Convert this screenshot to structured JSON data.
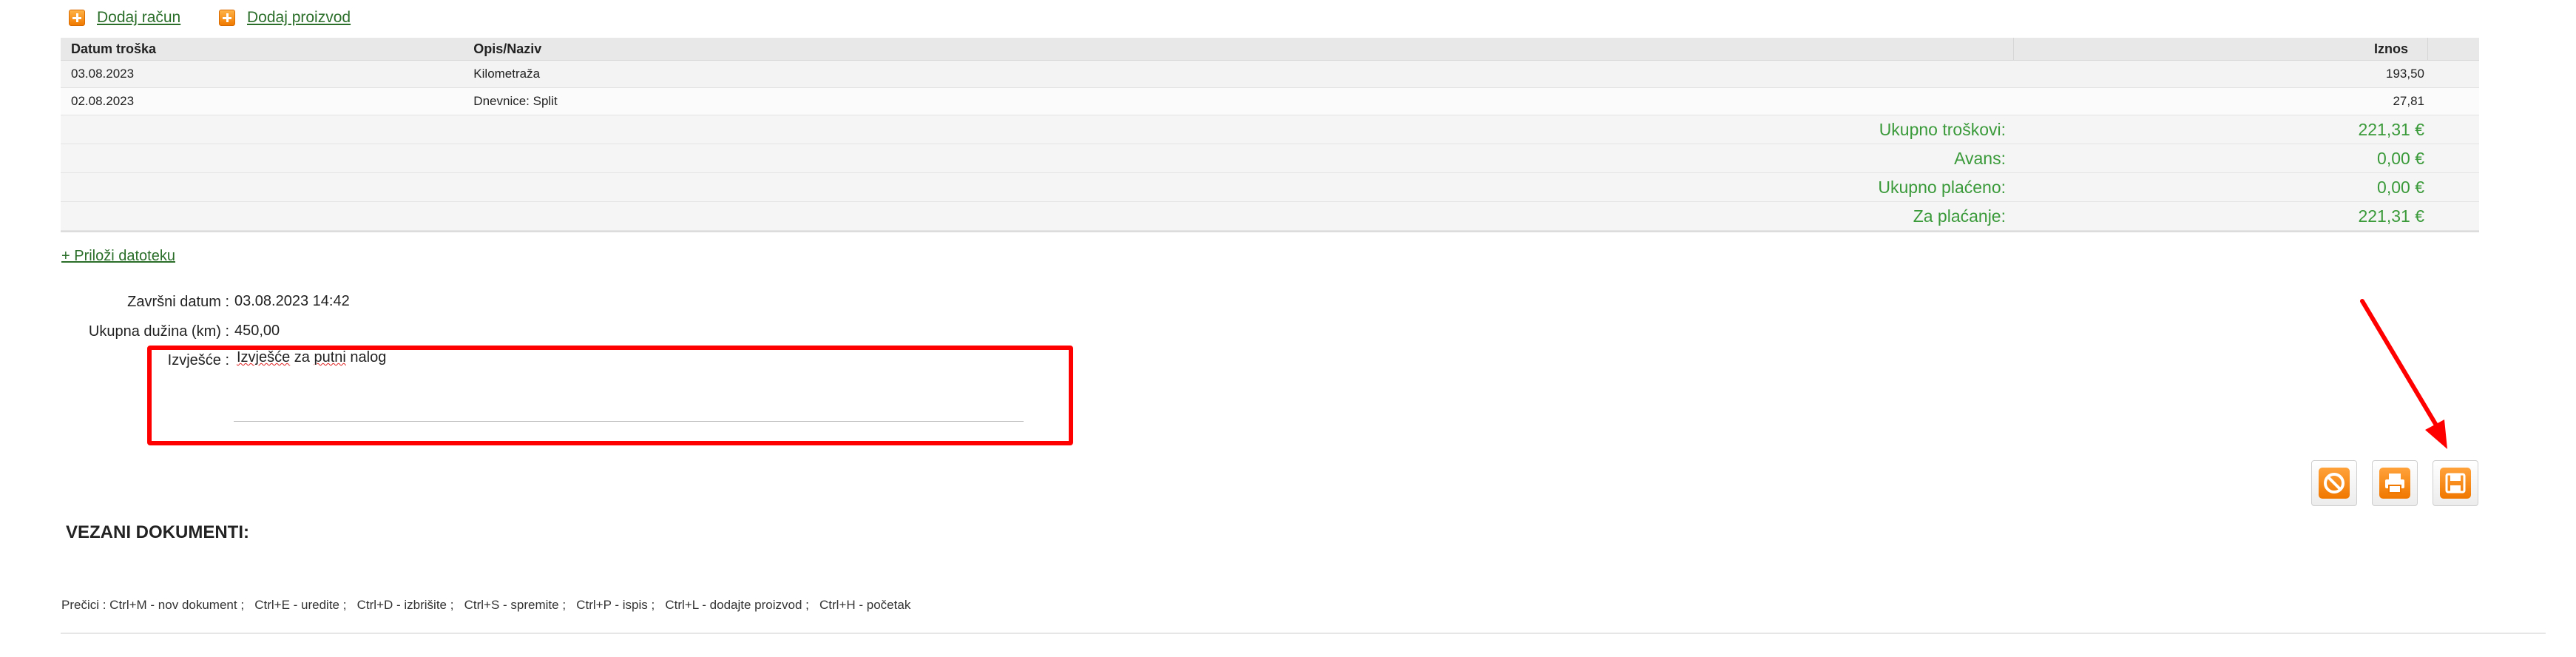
{
  "actions": {
    "add_invoice": "Dodaj račun",
    "add_product": "Dodaj proizvod",
    "attach_file": "+ Priloži datoteku"
  },
  "table": {
    "headers": {
      "date": "Datum troška",
      "desc": "Opis/Naziv",
      "amount": "Iznos"
    },
    "rows": [
      {
        "date": "03.08.2023",
        "desc": "Kilometraža",
        "amount": "193,50"
      },
      {
        "date": "02.08.2023",
        "desc": "Dnevnice: Split",
        "amount": "27,81"
      }
    ],
    "summary": [
      {
        "label": "Ukupno troškovi:",
        "value": "221,31 €"
      },
      {
        "label": "Avans:",
        "value": "0,00 €"
      },
      {
        "label": "Ukupno plaćeno:",
        "value": "0,00 €"
      },
      {
        "label": "Za plaćanje:",
        "value": "221,31 €"
      }
    ],
    "summary_color": "#3a9a3a"
  },
  "form": {
    "end_date_label": "Završni datum :",
    "end_date_value": "03.08.2023 14:42",
    "length_label": "Ukupna dužina (km) :",
    "length_value": "450,00",
    "report_label": "Izvješće :",
    "report_word1": "Izvješće",
    "report_word2": " za ",
    "report_word3": "putni",
    "report_word4": " nalog"
  },
  "buttons": {
    "cancel_icon": "cancel-icon",
    "print_icon": "print-icon",
    "save_icon": "save-icon",
    "accent": "#f07800"
  },
  "annotation_color": "#ff0000",
  "related_docs_title": "VEZANI DOKUMENTI:",
  "shortcuts_text": "Prečici : Ctrl+M - nov dokument ;   Ctrl+E - uredite ;   Ctrl+D - izbrišite ;   Ctrl+S - spremite ;   Ctrl+P - ispis ;   Ctrl+L - dodajte proizvod ;   Ctrl+H - početak"
}
